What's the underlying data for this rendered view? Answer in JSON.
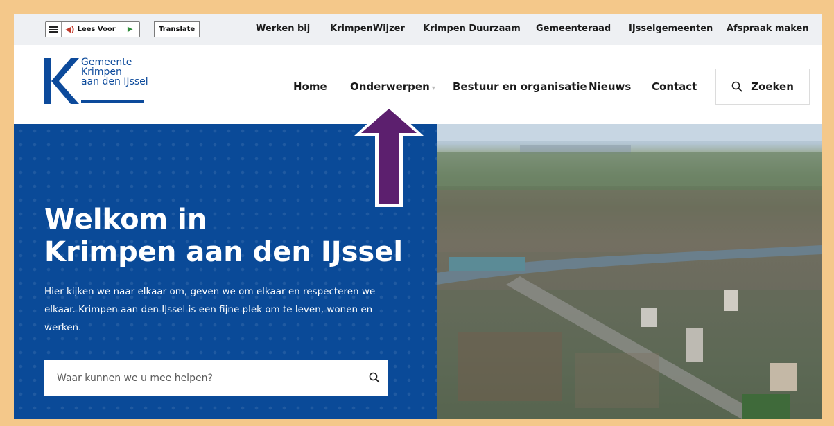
{
  "readspeaker": {
    "listen_label": "Lees Voor",
    "translate_label": "Translate"
  },
  "utility_links": [
    "Werken bij",
    "KrimpenWijzer",
    "Krimpen Duurzaam",
    "Gemeenteraad",
    "IJsselgemeenten",
    "Afspraak maken"
  ],
  "logo": {
    "line1": "Gemeente",
    "line2": "Krimpen",
    "line3": "aan den IJssel"
  },
  "nav": {
    "home": "Home",
    "onderwerpen": "Onderwerpen",
    "bestuur": "Bestuur en organisatie",
    "nieuws": "Nieuws",
    "contact": "Contact",
    "search": "Zoeken"
  },
  "hero": {
    "title_line1": "Welkom in",
    "title_line2": "Krimpen aan den IJssel",
    "intro": "Hier kijken we naar elkaar om, geven we om elkaar en respecteren we elkaar. Krimpen aan den IJssel is een fijne plek om te leven, wonen en werken.",
    "search_placeholder": "Waar kunnen we u mee helpen?"
  },
  "colors": {
    "brand_blue": "#0a4a98",
    "annotation_arrow": "#5c1f6e",
    "frame": "#f4c88a"
  },
  "icons": [
    "menu-icon",
    "speaker-icon",
    "play-icon",
    "search-icon"
  ]
}
